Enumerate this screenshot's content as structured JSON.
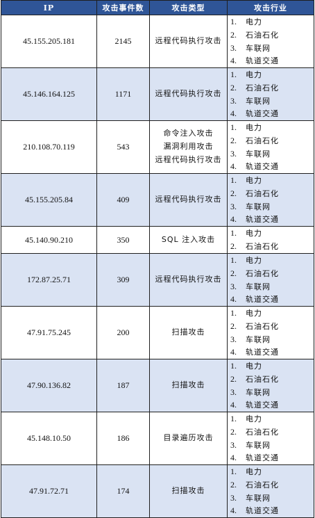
{
  "header": {
    "ip": "IP",
    "count": "攻击事件数",
    "type": "攻击类型",
    "industry": "攻击行业"
  },
  "rows": [
    {
      "ip": "45.155.205.181",
      "count": "2145",
      "types": [
        "远程代码执行攻击"
      ],
      "industries": [
        [
          "1.",
          "电力"
        ],
        [
          "2.",
          "石油石化"
        ],
        [
          "3.",
          "车联网"
        ],
        [
          "4.",
          "轨道交通"
        ]
      ]
    },
    {
      "ip": "45.146.164.125",
      "count": "1171",
      "types": [
        "远程代码执行攻击"
      ],
      "industries": [
        [
          "1.",
          "电力"
        ],
        [
          "2.",
          "石油石化"
        ],
        [
          "3.",
          "车联网"
        ],
        [
          "4.",
          "轨道交通"
        ]
      ]
    },
    {
      "ip": "210.108.70.119",
      "count": "543",
      "types": [
        "命令注入攻击",
        "漏洞利用攻击",
        "远程代码执行攻击"
      ],
      "industries": [
        [
          "1.",
          "电力"
        ],
        [
          "2.",
          "石油石化"
        ],
        [
          "3.",
          "车联网"
        ],
        [
          "4.",
          "轨道交通"
        ]
      ]
    },
    {
      "ip": "45.155.205.84",
      "count": "409",
      "types": [
        "远程代码执行攻击"
      ],
      "industries": [
        [
          "1.",
          "电力"
        ],
        [
          "2.",
          "石油石化"
        ],
        [
          "3.",
          "车联网"
        ],
        [
          "4.",
          "轨道交通"
        ]
      ]
    },
    {
      "ip": "45.140.90.210",
      "count": "350",
      "types": [
        "SQL 注入攻击"
      ],
      "industries": [
        [
          "1.",
          "电力"
        ],
        [
          "2.",
          "石油石化"
        ]
      ]
    },
    {
      "ip": "172.87.25.71",
      "count": "309",
      "types": [
        "远程代码执行攻击"
      ],
      "industries": [
        [
          "1.",
          "电力"
        ],
        [
          "2.",
          "石油石化"
        ],
        [
          "3.",
          "车联网"
        ],
        [
          "4.",
          "轨道交通"
        ]
      ]
    },
    {
      "ip": "47.91.75.245",
      "count": "200",
      "types": [
        "扫描攻击"
      ],
      "industries": [
        [
          "1.",
          "电力"
        ],
        [
          "2.",
          "石油石化"
        ],
        [
          "3.",
          "车联网"
        ],
        [
          "4.",
          "轨道交通"
        ]
      ]
    },
    {
      "ip": "47.90.136.82",
      "count": "187",
      "types": [
        "扫描攻击"
      ],
      "industries": [
        [
          "1.",
          "电力"
        ],
        [
          "2.",
          "石油石化"
        ],
        [
          "3.",
          "车联网"
        ],
        [
          "4.",
          "轨道交通"
        ]
      ]
    },
    {
      "ip": "45.148.10.50",
      "count": "186",
      "types": [
        "目录遍历攻击"
      ],
      "industries": [
        [
          "1.",
          "电力"
        ],
        [
          "2.",
          "石油石化"
        ],
        [
          "3.",
          "车联网"
        ],
        [
          "4.",
          "轨道交通"
        ]
      ]
    },
    {
      "ip": "47.91.72.71",
      "count": "174",
      "types": [
        "扫描攻击"
      ],
      "industries": [
        [
          "1.",
          "电力"
        ],
        [
          "2.",
          "石油石化"
        ],
        [
          "3.",
          "车联网"
        ],
        [
          "4.",
          "轨道交通"
        ]
      ]
    }
  ]
}
